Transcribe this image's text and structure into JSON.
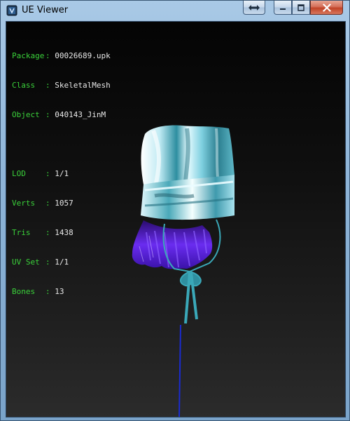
{
  "window": {
    "title": "UE Viewer"
  },
  "info": {
    "package": {
      "label": "Package",
      "value": "00026689.upk"
    },
    "class": {
      "label": "Class",
      "value": "SkeletalMesh"
    },
    "object": {
      "label": "Object",
      "value": "040143_JinM"
    },
    "lod": {
      "label": "LOD",
      "value": "1/1"
    },
    "verts": {
      "label": "Verts",
      "value": "1057"
    },
    "tris": {
      "label": "Tris",
      "value": "1438"
    },
    "uvset": {
      "label": "UV Set",
      "value": "1/1"
    },
    "bones": {
      "label": "Bones",
      "value": "13"
    }
  },
  "colors": {
    "label_green": "#3ad13a",
    "value_white": "#e8e8e8",
    "hair_purple": "#5a22d8",
    "headwear_teal": "#3aa8b8",
    "bone_line_blue": "#1a2bd0"
  },
  "icons": {
    "app": "ue-viewer-app-icon",
    "swap": "swap-arrows-icon",
    "minimize": "minimize-icon",
    "maximize": "maximize-icon",
    "close": "close-icon"
  }
}
